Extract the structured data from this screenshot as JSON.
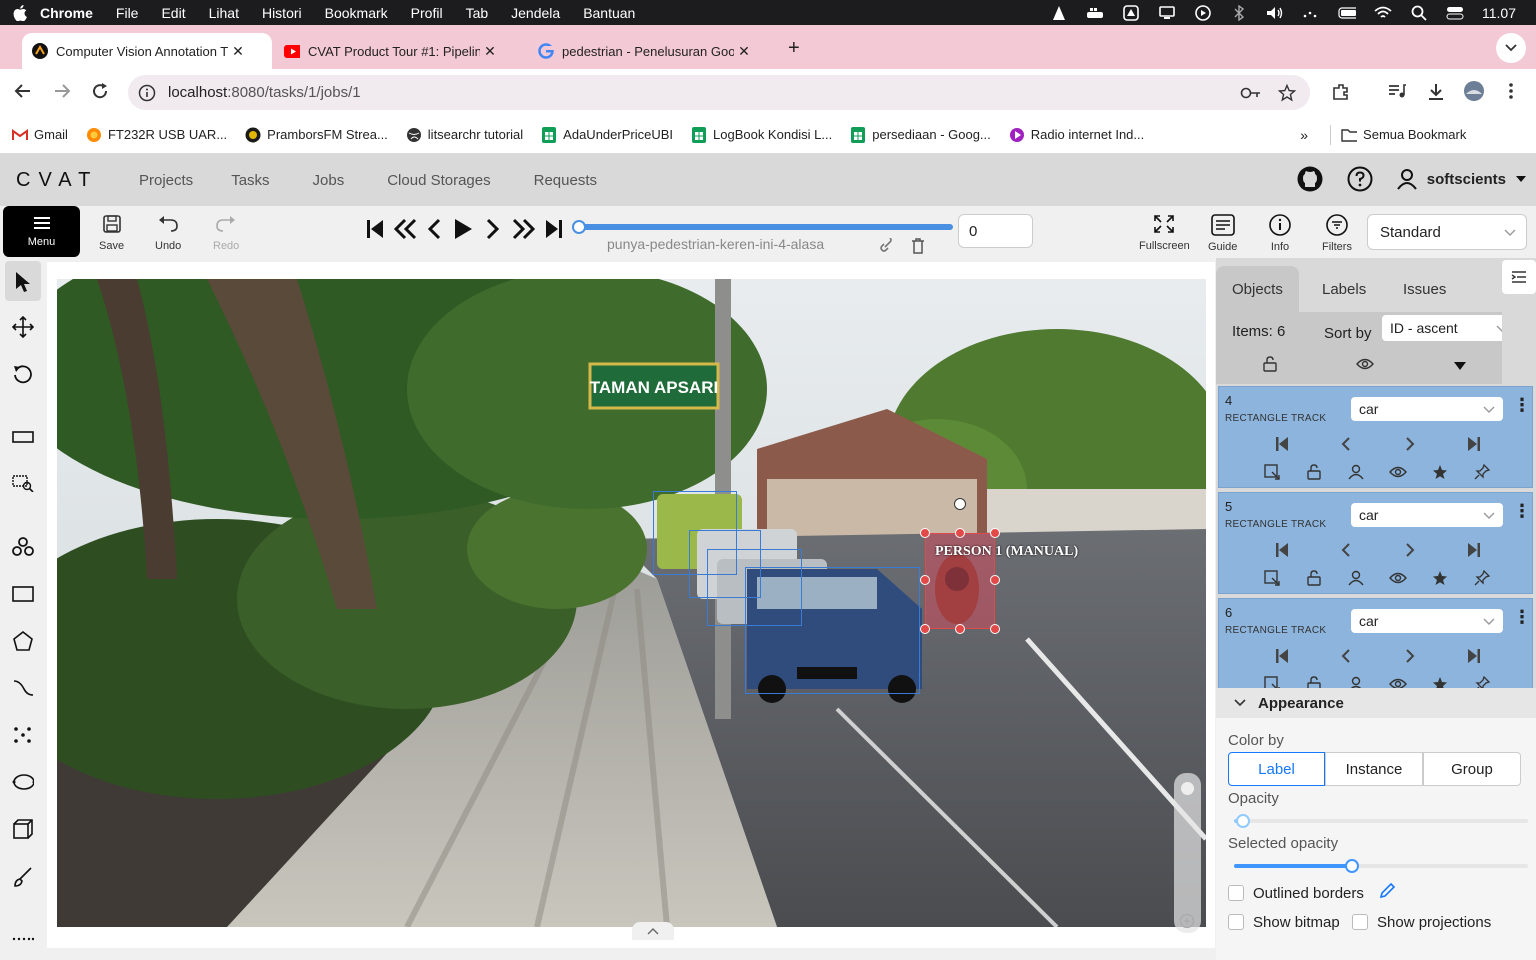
{
  "menubar": {
    "app": "Chrome",
    "items": [
      "File",
      "Edit",
      "Lihat",
      "Histori",
      "Bookmark",
      "Profil",
      "Tab",
      "Jendela",
      "Bantuan"
    ],
    "clock": "11.07"
  },
  "tabs": [
    {
      "title": "Computer Vision Annotation T",
      "icon": "cvat-icon"
    },
    {
      "title": "CVAT Product Tour #1: Pipelin",
      "icon": "youtube-icon"
    },
    {
      "title": "pedestrian - Penelusuran Goo",
      "icon": "google-icon"
    }
  ],
  "address": {
    "host": "localhost",
    "path": ":8080/tasks/1/jobs/1"
  },
  "bookmarks": [
    {
      "label": "Gmail",
      "icon": "gmail-icon",
      "color": "#d93025"
    },
    {
      "label": "FT232R USB UAR...",
      "icon": "firefox-icon",
      "color": "#ff8a00"
    },
    {
      "label": "PramborsFM Strea...",
      "icon": "prambors-icon",
      "color": "#c8a000"
    },
    {
      "label": "litsearchr tutorial",
      "icon": "globe-icon",
      "color": "#333333"
    },
    {
      "label": "AdaUnderPriceUBI",
      "icon": "sheets-icon",
      "color": "#0f9d58"
    },
    {
      "label": "LogBook Kondisi L...",
      "icon": "sheets-icon",
      "color": "#0f9d58"
    },
    {
      "label": "persediaan - Goog...",
      "icon": "sheets-icon",
      "color": "#0f9d58"
    },
    {
      "label": "Radio internet Ind...",
      "icon": "radio-icon",
      "color": "#a020c0"
    }
  ],
  "bookmarks_all": "Semua Bookmark",
  "cvat": {
    "logo": "CVAT",
    "nav": [
      "Projects",
      "Tasks",
      "Jobs",
      "Cloud Storages",
      "Requests"
    ],
    "username": "softscients"
  },
  "topbar": {
    "menu": "Menu",
    "save": "Save",
    "undo": "Undo",
    "redo": "Redo",
    "job_name": "punya-pedestrian-keren-ini-4-alasa",
    "frame": "0",
    "fullscreen": "Fullscreen",
    "guide": "Guide",
    "info": "Info",
    "filters": "Filters",
    "workspace": "Standard"
  },
  "canvas": {
    "sign_text": "TAMAN APSARI",
    "person_label": "PERSON 1 (MANUAL)"
  },
  "sidebar": {
    "tabs": [
      "Objects",
      "Labels",
      "Issues"
    ],
    "items_count": "Items: 6",
    "sort_by": "Sort by",
    "sort_value": "ID - ascent",
    "objects": [
      {
        "id": "4",
        "type": "RECTANGLE TRACK",
        "label": "car"
      },
      {
        "id": "5",
        "type": "RECTANGLE TRACK",
        "label": "car"
      },
      {
        "id": "6",
        "type": "RECTANGLE TRACK",
        "label": "car"
      }
    ],
    "appearance": {
      "title": "Appearance",
      "color_by": "Color by",
      "color_options": [
        "Label",
        "Instance",
        "Group"
      ],
      "selected_color_option": "Label",
      "opacity": "Opacity",
      "opacity_value": 0.03,
      "selected_opacity": "Selected opacity",
      "selected_opacity_value": 0.4,
      "outlined_borders": "Outlined borders",
      "show_bitmap": "Show bitmap",
      "show_projections": "Show projections"
    }
  },
  "colors": {
    "accent": "#1677ff",
    "card": "#8cb4dc",
    "bbox": "#3a7bd5",
    "person": "#e24a4a"
  }
}
